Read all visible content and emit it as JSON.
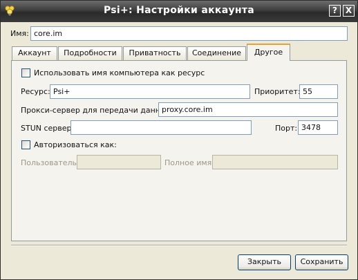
{
  "window": {
    "title": "Psi+: Настройки аккаунта",
    "help_glyph": "?",
    "close_glyph": "X"
  },
  "name_label": "Имя:",
  "name_value": "core.im",
  "tabs": [
    {
      "label": "Аккаунт",
      "active": false
    },
    {
      "label": "Подробности",
      "active": false
    },
    {
      "label": "Приватность",
      "active": false
    },
    {
      "label": "Соединение",
      "active": false
    },
    {
      "label": "Другое",
      "active": true
    }
  ],
  "other": {
    "use_hostname_label": "Использовать имя компьютера как ресурс",
    "use_hostname_checked": false,
    "resource_label": "Ресурс:",
    "resource_value": "Psi+",
    "priority_label": "Приоритет:",
    "priority_value": "55",
    "proxy_label": "Прокси-сервер для передачи данных:",
    "proxy_value": "proxy.core.im",
    "stun_label": "STUN сервер:",
    "stun_value": "",
    "port_label": "Порт:",
    "port_value": "3478",
    "auth_as_label": "Авторизоваться как:",
    "auth_as_checked": false,
    "user_label": "Пользователь:",
    "user_value": "",
    "fullname_label": "Полное имя:",
    "fullname_value": ""
  },
  "buttons": {
    "close_label": "Закрыть",
    "save_label": "Сохранить"
  }
}
